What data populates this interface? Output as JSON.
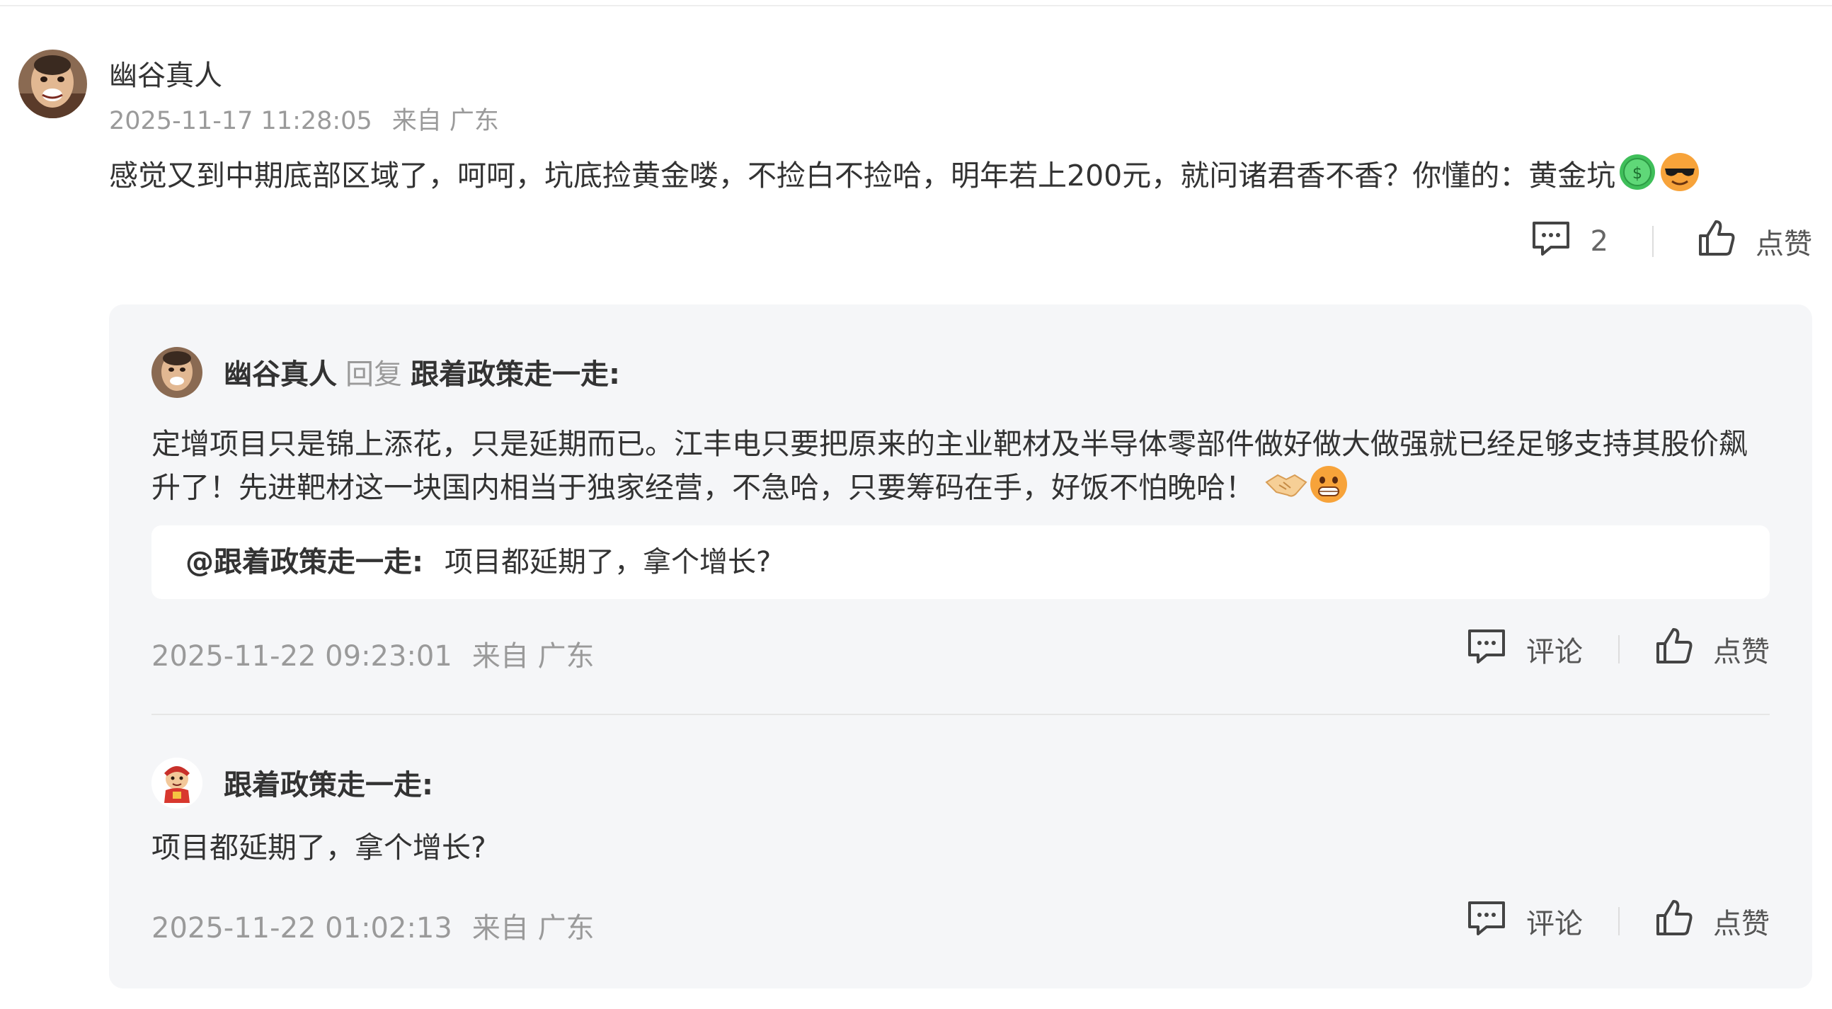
{
  "comment": {
    "user_name": "幽谷真人",
    "timestamp": "2025-11-17 11:28:05",
    "location": "来自 广东",
    "text": "感觉又到中期底部区域了，呵呵，坑底捡黄金喽，不捡白不捡哈，明年若上200元，就问诸君香不香？你懂的：黄金坑",
    "emoji_1": "money-badge-emoji",
    "emoji_2": "sunglasses-emoji",
    "reply_count": "2",
    "like_label": "点赞"
  },
  "replies": [
    {
      "user_name": "幽谷真人",
      "reply_word": "回复",
      "reply_to": "跟着政策走一走:",
      "text": "定增项目只是锦上添花，只是延期而已。江丰电只要把原来的主业靶材及半导体零部件做好做大做强就已经足够支持其股价飙升了！先进靶材这一块国内相当于独家经营，不急哈，只要筹码在手，好饭不怕晚哈！",
      "emoji_1": "handshake-emoji",
      "emoji_2": "grin-emoji",
      "quote_name": "@跟着政策走一走:",
      "quote_text": "项目都延期了，拿个增长?",
      "timestamp": "2025-11-22 09:23:01",
      "location": "来自 广东",
      "comment_label": "评论",
      "like_label": "点赞"
    },
    {
      "user_name": "跟着政策走一走:",
      "text": "项目都延期了，拿个增长?",
      "timestamp": "2025-11-22 01:02:13",
      "location": "来自 广东",
      "comment_label": "评论",
      "like_label": "点赞"
    }
  ]
}
